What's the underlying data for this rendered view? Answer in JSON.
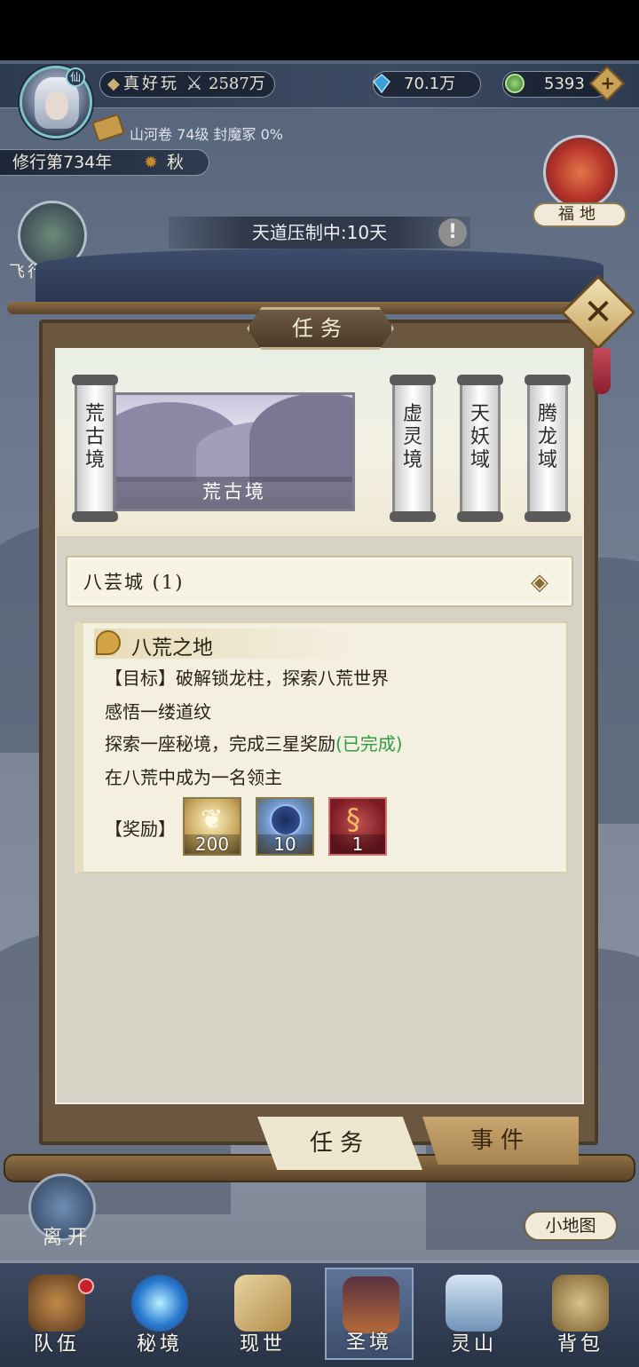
{
  "player": {
    "name": "真好玩",
    "power": "2587万",
    "spirit_stones": "70.1万",
    "jade": "5393",
    "avatar_badge": "仙",
    "sub_line": "山河卷 74级 封魔冢 0%",
    "cultivation_year": "修行第734年",
    "season": "秋"
  },
  "side": {
    "fudi_label": "福地",
    "fly_label": "飞行法",
    "heaven_suppress": "天道压制中:10天",
    "leave_label": "离开",
    "minimap_label": "小地图"
  },
  "panel": {
    "title": "任务",
    "regions": [
      "荒古境",
      "虚灵境",
      "天妖域",
      "腾龙域"
    ],
    "selected_region_banner": "荒古境",
    "city": "八芸城 (1)",
    "quest": {
      "title": "八荒之地",
      "lines": [
        "【目标】破解锁龙柱，探索八荒世界",
        "感悟一缕道纹",
        "探索一座秘境，完成三星奖励",
        "在八荒中成为一名领主"
      ],
      "completed_tag": "(已完成)",
      "reward_label": "【奖励】",
      "rewards": [
        {
          "icon": "feather-icon",
          "count": "200"
        },
        {
          "icon": "orb-icon",
          "count": "10"
        },
        {
          "icon": "dragon-icon",
          "count": "1"
        }
      ]
    },
    "tabs": {
      "task": "任务",
      "event": "事件"
    }
  },
  "nav": [
    "队伍",
    "秘境",
    "现世",
    "圣境",
    "灵山",
    "背包"
  ],
  "colors": {
    "done": "#2f9c46",
    "accent": "#c8a258"
  }
}
